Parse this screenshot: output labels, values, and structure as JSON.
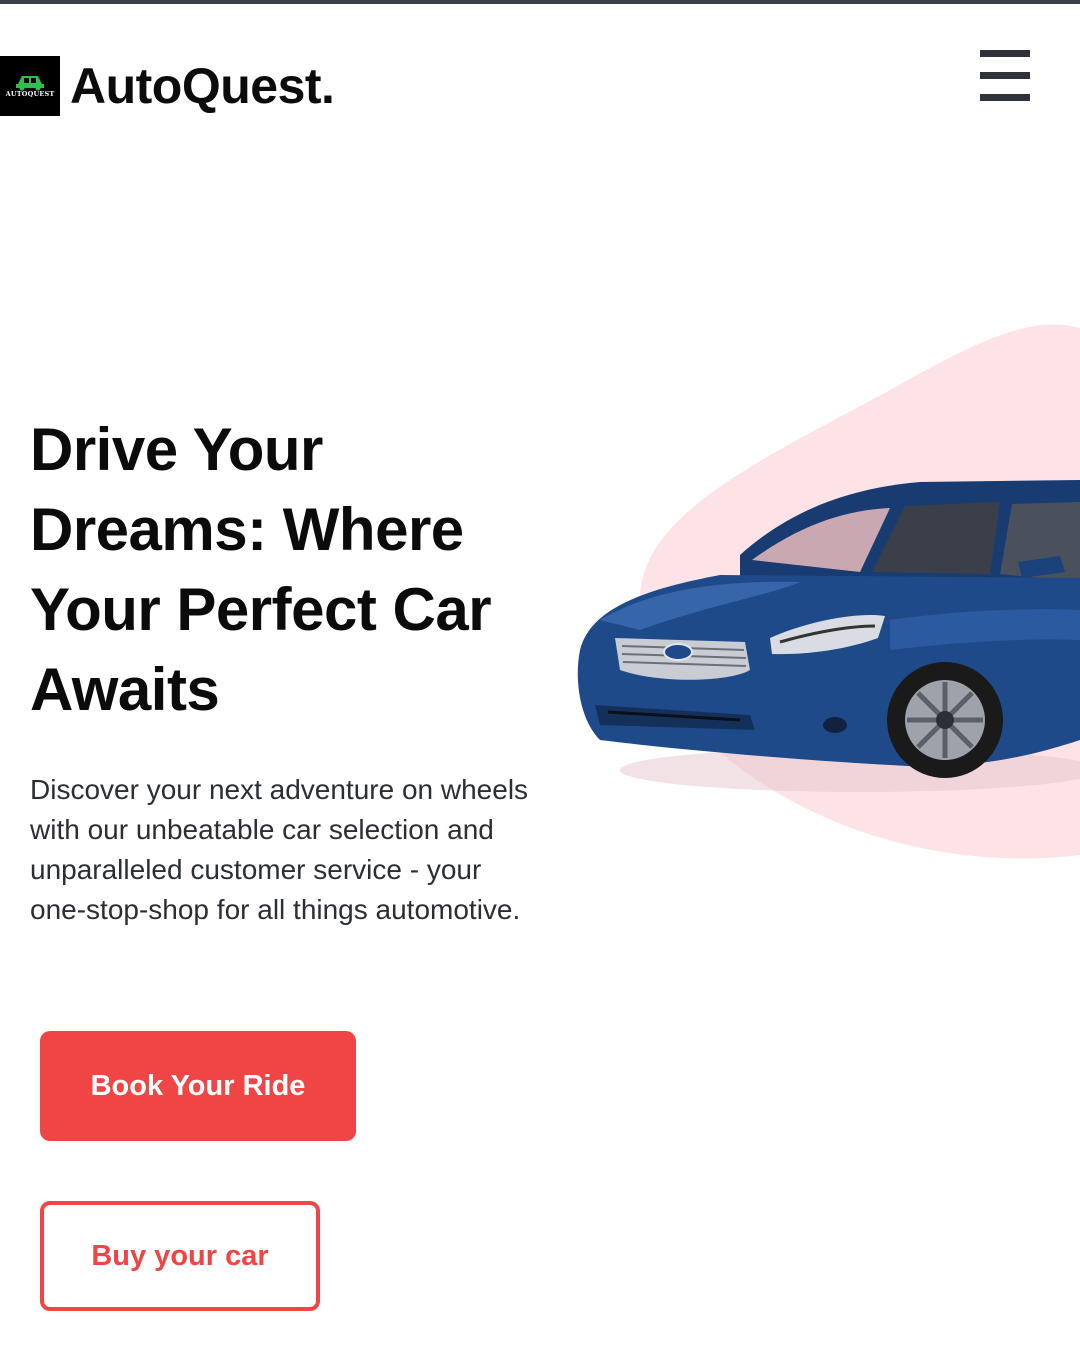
{
  "header": {
    "logo_text": "AUTOQUEST",
    "brand": "AutoQuest.",
    "menu_icon": "hamburger-menu-icon"
  },
  "hero": {
    "title": "Drive Your Dreams: Where Your Perfect Car Awaits",
    "description": "Discover your next adventure on wheels with our unbeatable car selection and unparalleled customer service - your one-stop-shop for all things automotive.",
    "primary_button": "Book Your Ride",
    "secondary_button": "Buy your car"
  },
  "colors": {
    "accent": "#ef4545",
    "blob": "#fde2e6",
    "car_body": "#1f4a8a",
    "text_dark": "#0b0b0b",
    "top_bar": "#3b4048"
  }
}
